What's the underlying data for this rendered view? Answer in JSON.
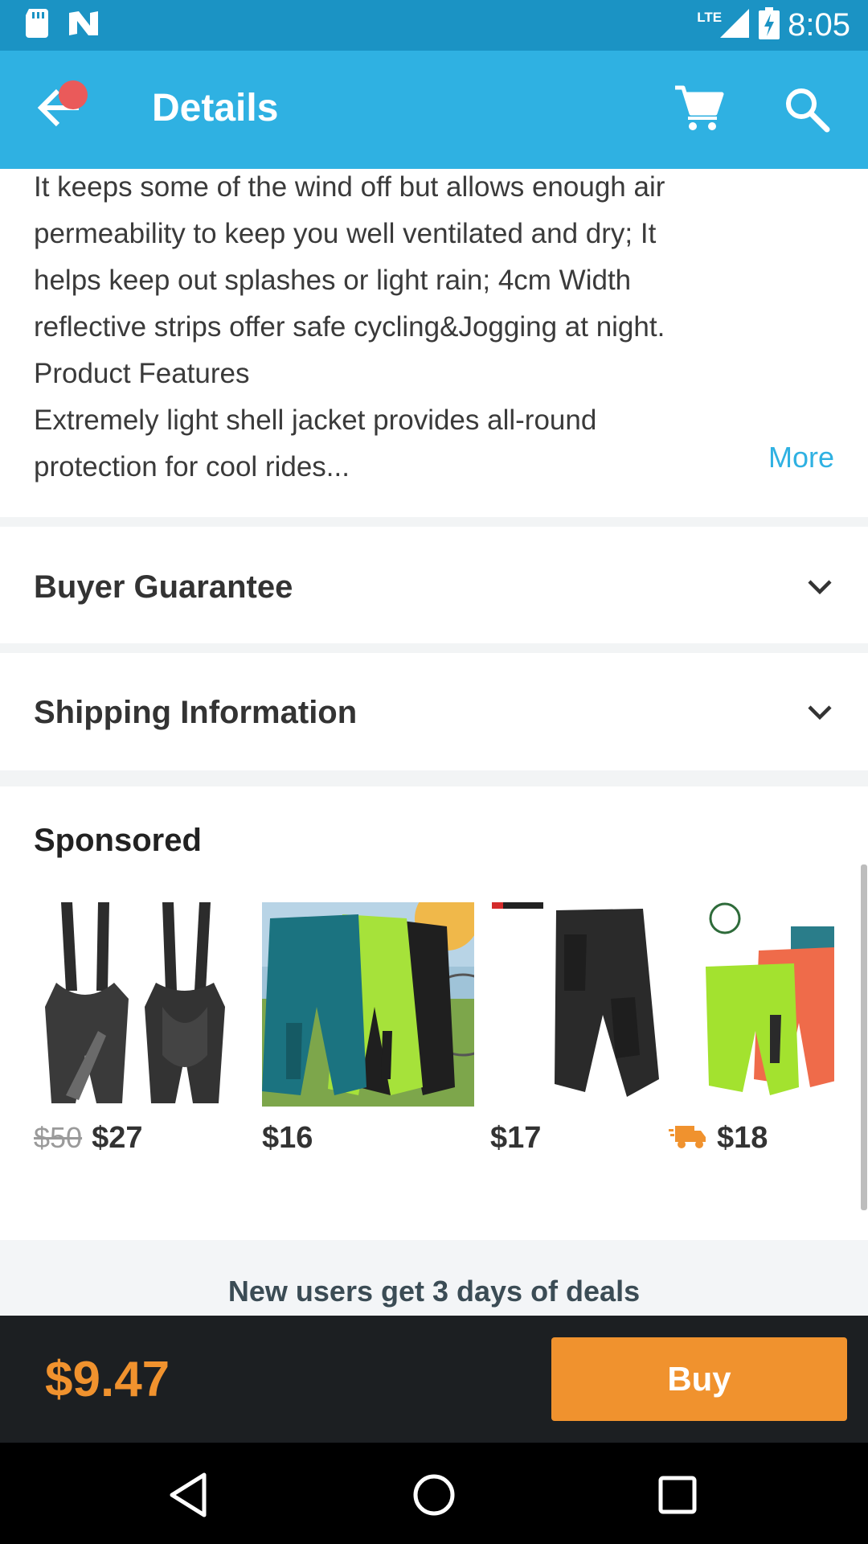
{
  "status_bar": {
    "time": "8:05",
    "network": "LTE",
    "icons": [
      "sd-card-icon",
      "n-icon",
      "signal-icon",
      "battery-charging-icon"
    ]
  },
  "app_bar": {
    "title": "Details",
    "icons": [
      "back-arrow-icon",
      "notification-dot",
      "cart-icon",
      "search-icon"
    ]
  },
  "description": {
    "lines": [
      "It keeps some of the wind off but allows enough air",
      "permeability to keep you well ventilated and dry; It",
      "helps keep out splashes or light rain; 4cm Width",
      "reflective strips offer safe cycling&Jogging at night.",
      "Product Features",
      "Extremely light shell jacket provides all-round",
      "protection for cool rides..."
    ],
    "more_label": "More"
  },
  "sections": {
    "buyer_guarantee": "Buyer Guarantee",
    "shipping_information": "Shipping Information"
  },
  "sponsored": {
    "title": "Sponsored",
    "products": [
      {
        "old_price": "$50",
        "price": "$27",
        "name": "bib-shorts"
      },
      {
        "price": "$16",
        "name": "cycling-shorts-teal-green"
      },
      {
        "price": "$17",
        "name": "cycling-shorts-black"
      },
      {
        "price": "$18",
        "name": "cycling-shorts-lime",
        "badge": "shipping-truck-icon"
      }
    ]
  },
  "promo": {
    "text": "New users get 3 days of deals"
  },
  "purchase": {
    "price": "$9.47",
    "buy_label": "Buy"
  },
  "nav_bar": {
    "icons": [
      "back-triangle-icon",
      "home-circle-icon",
      "recents-square-icon"
    ]
  },
  "colors": {
    "status_bar": "#1b93c4",
    "app_bar": "#2fb1e2",
    "accent_orange": "#f0922e",
    "link_blue": "#2fb1e2",
    "buy_bar": "#1c1f22"
  }
}
